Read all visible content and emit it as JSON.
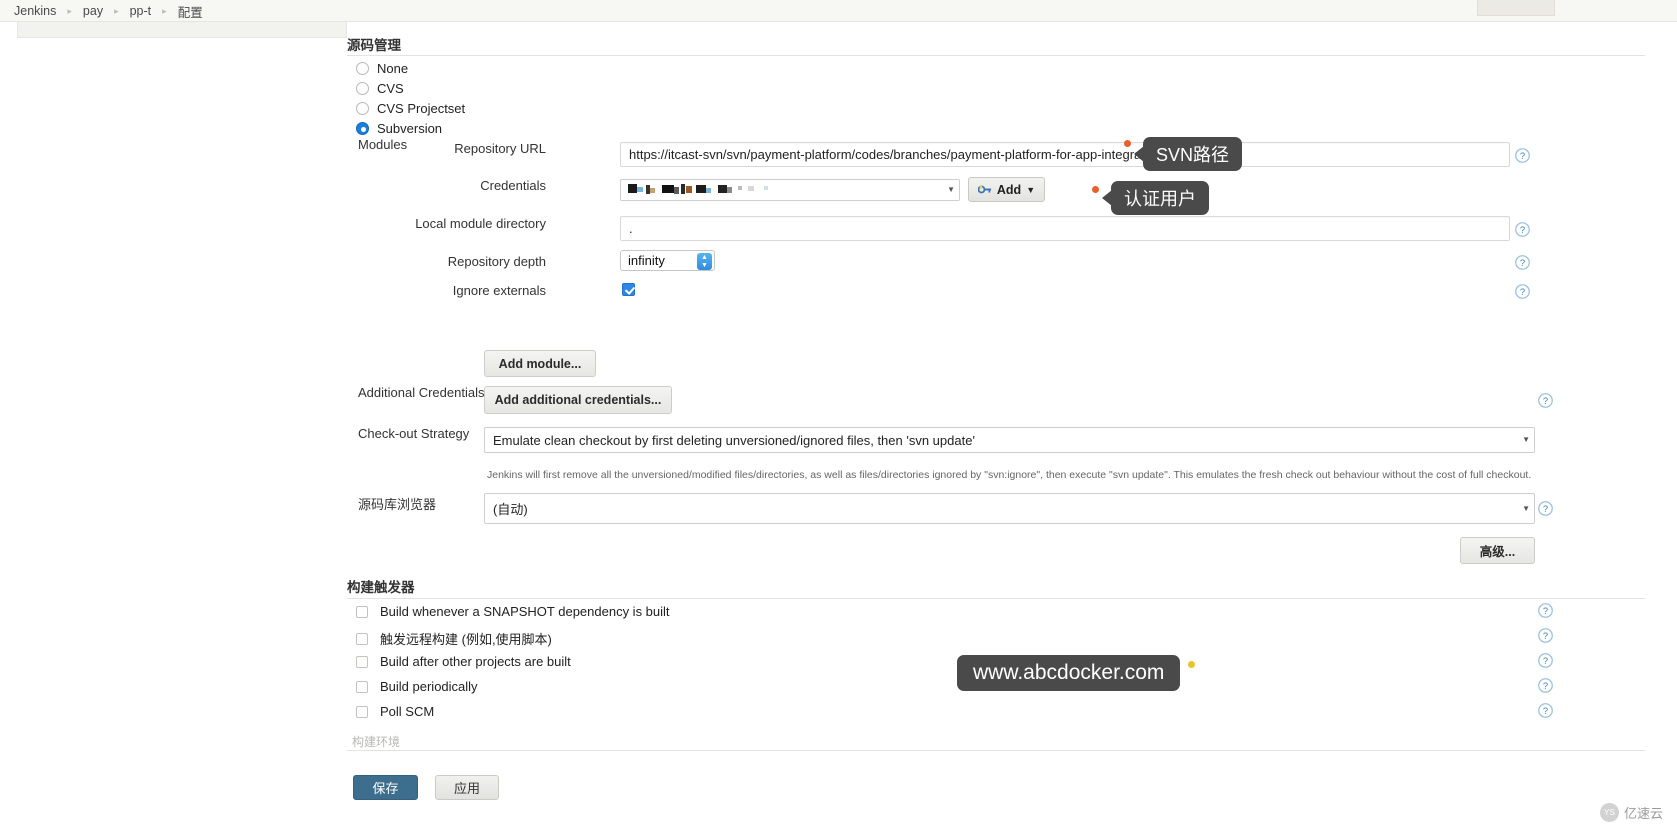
{
  "breadcrumb": {
    "items": [
      "Jenkins",
      "pay",
      "pp-t",
      "配置"
    ],
    "separator": "▸"
  },
  "scm": {
    "section_title": "源码管理",
    "radios": [
      {
        "label": "None",
        "checked": false
      },
      {
        "label": "CVS",
        "checked": false
      },
      {
        "label": "CVS Projectset",
        "checked": false
      },
      {
        "label": "Subversion",
        "checked": true
      }
    ],
    "modules_label": "Modules",
    "repository_url": {
      "label": "Repository URL",
      "value": "https://itcast-svn/svn/payment-platform/codes/branches/payment-platform-for-app-integrate"
    },
    "credentials": {
      "label": "Credentials",
      "value": "",
      "add_button": "Add",
      "add_icon": "key-icon"
    },
    "local_module_directory": {
      "label": "Local module directory",
      "value": "."
    },
    "repository_depth": {
      "label": "Repository depth",
      "value": "infinity"
    },
    "ignore_externals": {
      "label": "Ignore externals",
      "checked": true
    },
    "add_module_button": "Add module...",
    "additional_credentials": {
      "label": "Additional Credentials",
      "button": "Add additional credentials..."
    },
    "checkout_strategy": {
      "label": "Check-out Strategy",
      "value": "Emulate clean checkout by first deleting unversioned/ignored files, then 'svn update'",
      "help": "Jenkins will first remove all the unversioned/modified files/directories, as well as files/directories ignored by \"svn:ignore\", then execute \"svn update\". This emulates the fresh check out behaviour without the cost of full checkout."
    },
    "repository_browser": {
      "label": "源码库浏览器",
      "value": "(自动)"
    },
    "advanced_button": "高级..."
  },
  "triggers": {
    "section_title": "构建触发器",
    "items": [
      {
        "label": "Build whenever a SNAPSHOT dependency is built",
        "checked": false
      },
      {
        "label": "触发远程构建 (例如,使用脚本)",
        "checked": false
      },
      {
        "label": "Build after other projects are built",
        "checked": false
      },
      {
        "label": "Build periodically",
        "checked": false
      },
      {
        "label": "Poll SCM",
        "checked": false
      }
    ]
  },
  "build_env": {
    "section_title": "构建环境"
  },
  "footer": {
    "save": "保存",
    "apply": "应用"
  },
  "annotations": [
    {
      "text": "SVN路径",
      "name": "callout-svn-path"
    },
    {
      "text": "认证用户",
      "name": "callout-auth-user"
    }
  ],
  "watermark": {
    "text": "www.abcdocker.com"
  },
  "brand": {
    "text": "亿速云",
    "logo": "YS"
  },
  "colors": {
    "callout_bg": "#4a4a4a",
    "dot_orange": "#e8602c",
    "dot_yellow": "#e8c32c",
    "accent_blue": "#2f86e8",
    "save_blue": "#3e6e8e"
  }
}
